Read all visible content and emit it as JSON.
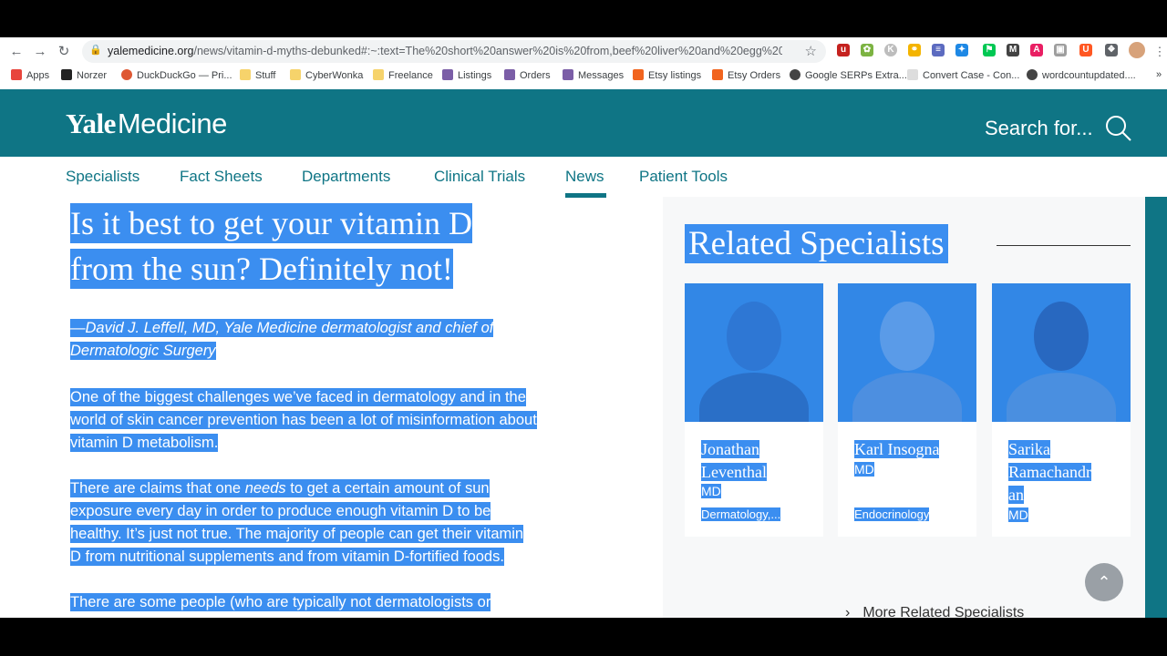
{
  "browser": {
    "url_host": "yalemedicine.org",
    "url_path": "/news/vitamin-d-myths-debunked#:~:text=The%20short%20answer%20is%20from,beef%20liver%20and%20egg%20yolks.",
    "bookmarks": [
      "Apps",
      "Norzer",
      "DuckDuckGo — Pri...",
      "Stuff",
      "CyberWonka",
      "Freelance",
      "Listings",
      "Orders",
      "Messages",
      "Etsy listings",
      "Etsy Orders",
      "Google SERPs Extra...",
      "Convert Case - Con...",
      "wordcountupdated...."
    ]
  },
  "site": {
    "logo_yale": "Yale",
    "logo_medicine": "Medicine",
    "search_placeholder": "Search for...",
    "tabs": [
      "Specialists",
      "Fact Sheets",
      "Departments",
      "Clinical Trials",
      "News",
      "Patient Tools"
    ],
    "active_tab": "News"
  },
  "article": {
    "title_line1": "Is it best to get your vitamin D",
    "title_line2": "from the sun? Definitely not!",
    "quote_line1": "—David J. Leffell, MD, Yale Medicine dermatologist and chief of",
    "quote_line2": "Dermatologic Surgery",
    "p1": [
      "One of the biggest challenges we’ve faced in dermatology and in the",
      "world of skin cancer prevention has been a lot of misinformation about",
      "vitamin D metabolism."
    ],
    "p2_a": "There are claims that one ",
    "p2_em": "needs",
    "p2_b": " to get a certain amount of sun",
    "p2_rest": [
      "exposure every day in order to produce enough vitamin D to be",
      "healthy. It’s just not true. The majority of people can get their vitamin",
      "D from nutritional supplements and from vitamin D-fortified foods."
    ],
    "p3": "There are some people (who are typically not dermatologists or"
  },
  "related": {
    "title": "Related Specialists",
    "cards": [
      {
        "name_lines": [
          "Jonathan",
          "Leventhal"
        ],
        "cred": "MD",
        "spec": "Dermatology,..."
      },
      {
        "name_lines": [
          "Karl Insogna"
        ],
        "cred": "MD",
        "spec": "Endocrinology"
      },
      {
        "name_lines": [
          "Sarika",
          "Ramachandr",
          "an"
        ],
        "cred": "MD",
        "spec": ""
      }
    ],
    "more_link": "More Related Specialists"
  },
  "colors": {
    "brand": "#0f7585",
    "selection": "#3b8ef0"
  }
}
